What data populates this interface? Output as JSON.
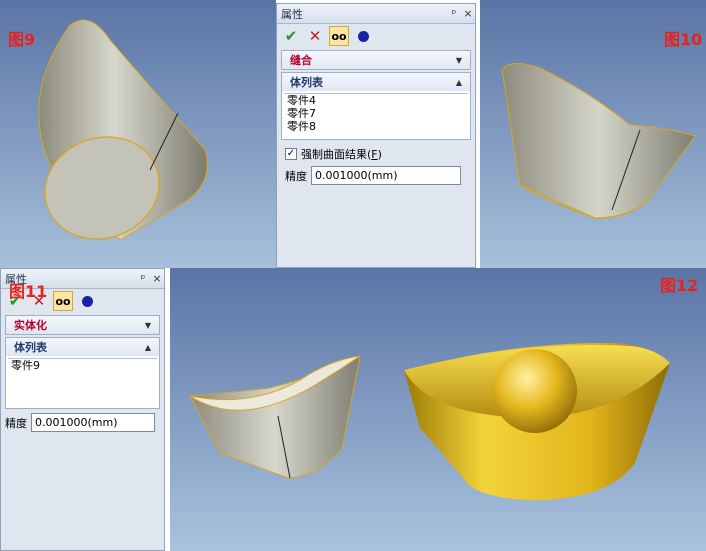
{
  "figures": {
    "fig9": "图9",
    "fig10": "图10",
    "fig11": "图11",
    "fig12": "图12"
  },
  "panel_top": {
    "title": "属性",
    "pin": "ᵖ",
    "close": "×",
    "op_label": "缝合",
    "body_list_title": "体列表",
    "items": [
      "零件4",
      "零件7",
      "零件8"
    ],
    "force_surface_label": "强制曲面结果(",
    "force_surface_key": "F",
    "force_surface_end": ")",
    "precision_label": "精度",
    "precision_value": "0.001000(mm)"
  },
  "panel_bottom": {
    "title": "属性",
    "pin": "ᵖ",
    "close": "×",
    "op_label": "实体化",
    "body_list_title": "体列表",
    "items": [
      "零件9"
    ],
    "precision_label": "精度",
    "precision_value": "0.001000(mm)"
  },
  "colors": {
    "viewport_top": "#5b77a8",
    "viewport_bottom": "#a9c3dd",
    "op_red": "#b7002b",
    "gold": "#e3b51c",
    "steel": "#b9b8a8"
  }
}
